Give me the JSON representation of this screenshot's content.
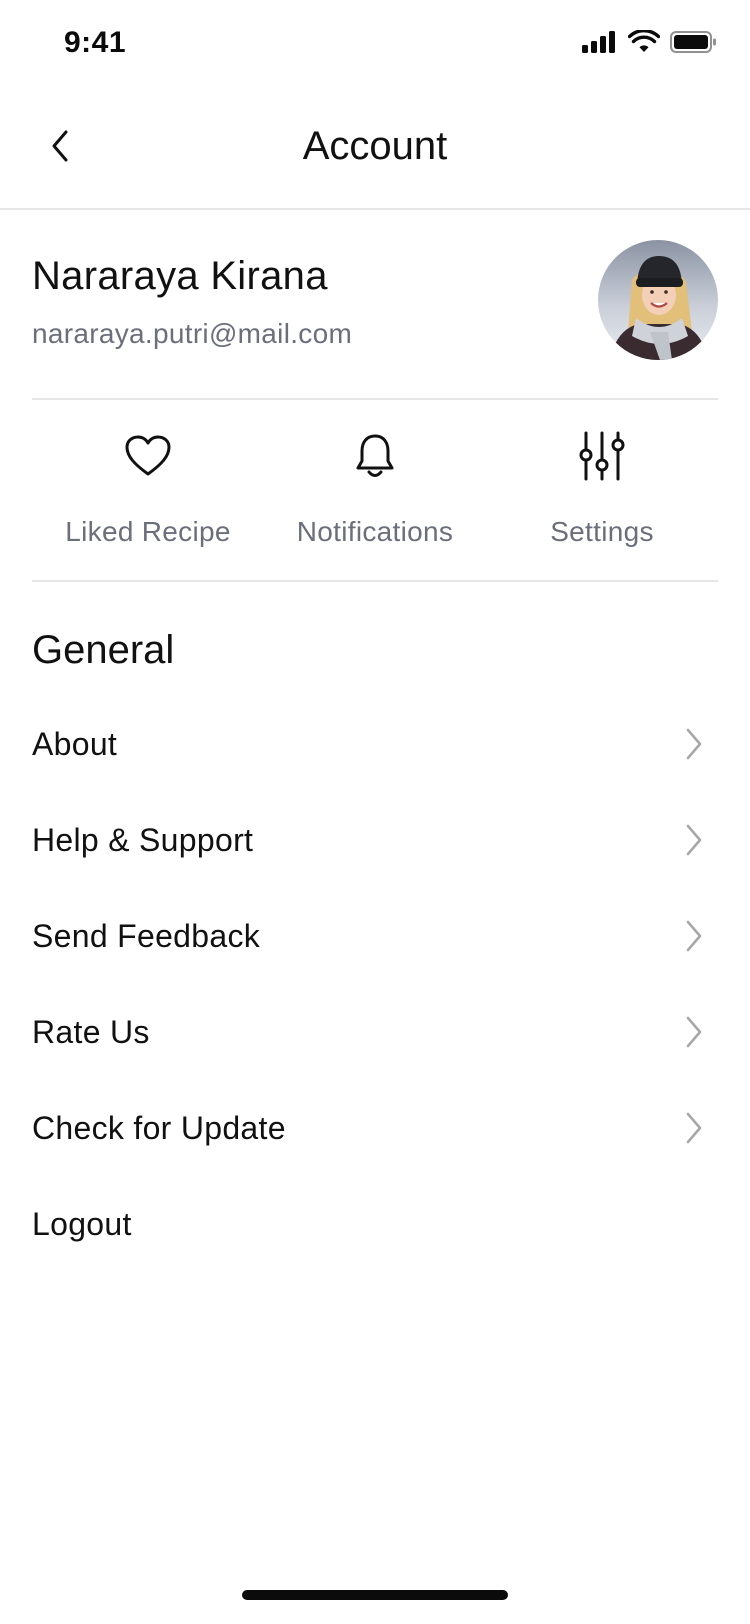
{
  "status_bar": {
    "time": "9:41",
    "icons": [
      "signal-icon",
      "wifi-icon",
      "battery-icon"
    ]
  },
  "header": {
    "title": "Account",
    "back_icon": "chevron-left-icon"
  },
  "profile": {
    "name": "Nararaya Kirana",
    "email": "nararaya.putri@mail.com"
  },
  "quick_actions": [
    {
      "label": "Liked Recipe",
      "icon": "heart-icon"
    },
    {
      "label": "Notifications",
      "icon": "bell-icon"
    },
    {
      "label": "Settings",
      "icon": "sliders-icon"
    }
  ],
  "general": {
    "title": "General",
    "items": [
      {
        "label": "About",
        "chevron": true
      },
      {
        "label": "Help & Support",
        "chevron": true
      },
      {
        "label": "Send Feedback",
        "chevron": true
      },
      {
        "label": "Rate Us",
        "chevron": true
      },
      {
        "label": "Check for Update",
        "chevron": true
      },
      {
        "label": "Logout",
        "chevron": false
      }
    ]
  },
  "colors": {
    "text_primary": "#111111",
    "text_secondary": "#6b6f7b",
    "divider": "#e6e6e6",
    "chevron": "#a8a8a8"
  }
}
